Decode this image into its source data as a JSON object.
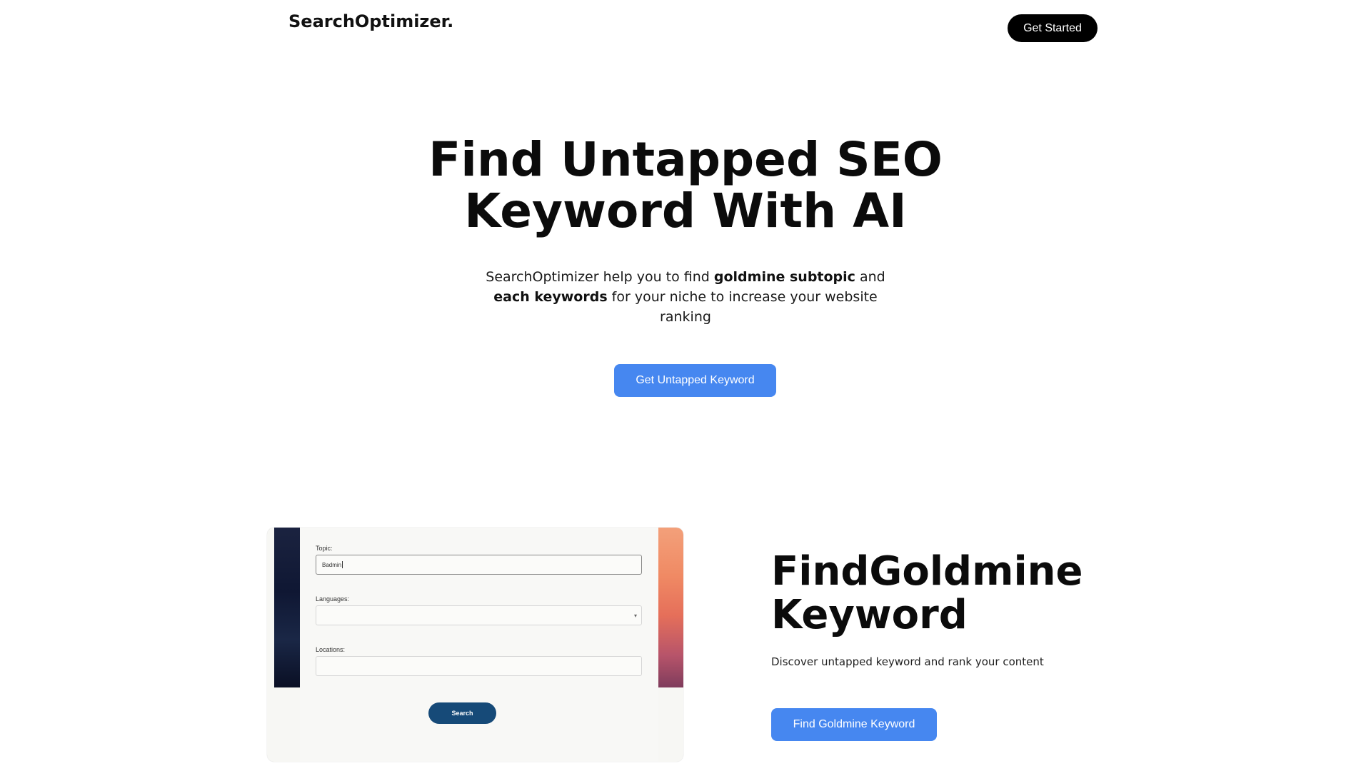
{
  "nav": {
    "logo": "SearchOptimizer.",
    "cta_label": "Get Started"
  },
  "hero": {
    "title_line1": "Find Untapped SEO",
    "title_line2": "Keyword With AI",
    "subtitle": {
      "part1": "SearchOptimizer help you to find ",
      "bold1": "goldmine subtopic",
      "part2": " and ",
      "bold2": "each keywords",
      "part3": " for your niche to increase your website ranking"
    },
    "cta_label": "Get Untapped Keyword"
  },
  "preview_form": {
    "topic_label": "Topic:",
    "topic_value": "Badmin",
    "languages_label": "Languages:",
    "languages_value": "",
    "locations_label": "Locations:",
    "locations_value": "",
    "search_label": "Search"
  },
  "feature": {
    "title_line1": "FindGoldmine",
    "title_line2": "Keyword",
    "subtitle": "Discover untapped keyword and rank your content",
    "cta_label": "Find Goldmine Keyword"
  },
  "colors": {
    "primary_button": "#4687f0",
    "dark_button": "#000000",
    "form_search_button": "#164a78"
  }
}
